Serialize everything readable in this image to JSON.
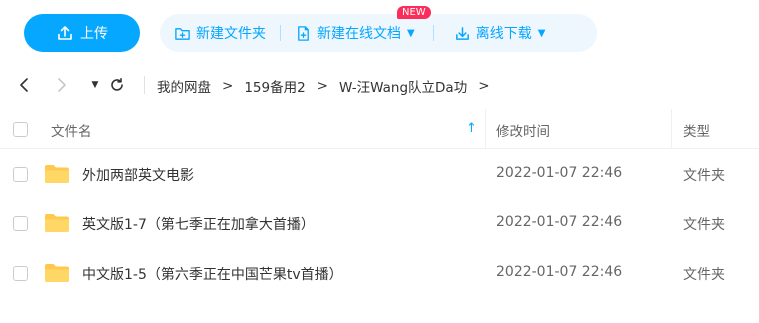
{
  "toolbar": {
    "upload_label": "上传",
    "new_folder_label": "新建文件夹",
    "new_online_doc_label": "新建在线文档",
    "new_badge": "NEW",
    "offline_download_label": "离线下载"
  },
  "nav": {
    "back_icon": "<",
    "forward_icon": ">",
    "more_icon": "▼",
    "refresh_icon": "⟳",
    "separator": ">",
    "breadcrumbs": [
      "我的网盘",
      "159备用2",
      "W-汪Wang队立Da功"
    ]
  },
  "table": {
    "headers": {
      "name": "文件名",
      "modified": "修改时间",
      "type": "类型"
    },
    "sort_icon": "↑",
    "rows": [
      {
        "name": "外加两部英文电影",
        "modified": "2022-01-07 22:46",
        "type": "文件夹"
      },
      {
        "name": "英文版1-7（第七季正在加拿大首播）",
        "modified": "2022-01-07 22:46",
        "type": "文件夹"
      },
      {
        "name": "中文版1-5（第六季正在中国芒果tv首播）",
        "modified": "2022-01-07 22:46",
        "type": "文件夹"
      }
    ]
  },
  "colors": {
    "accent": "#06a7ff",
    "action_bg": "#eef6fe",
    "badge": "#fb2d5a",
    "folder": "#ffc94d"
  }
}
